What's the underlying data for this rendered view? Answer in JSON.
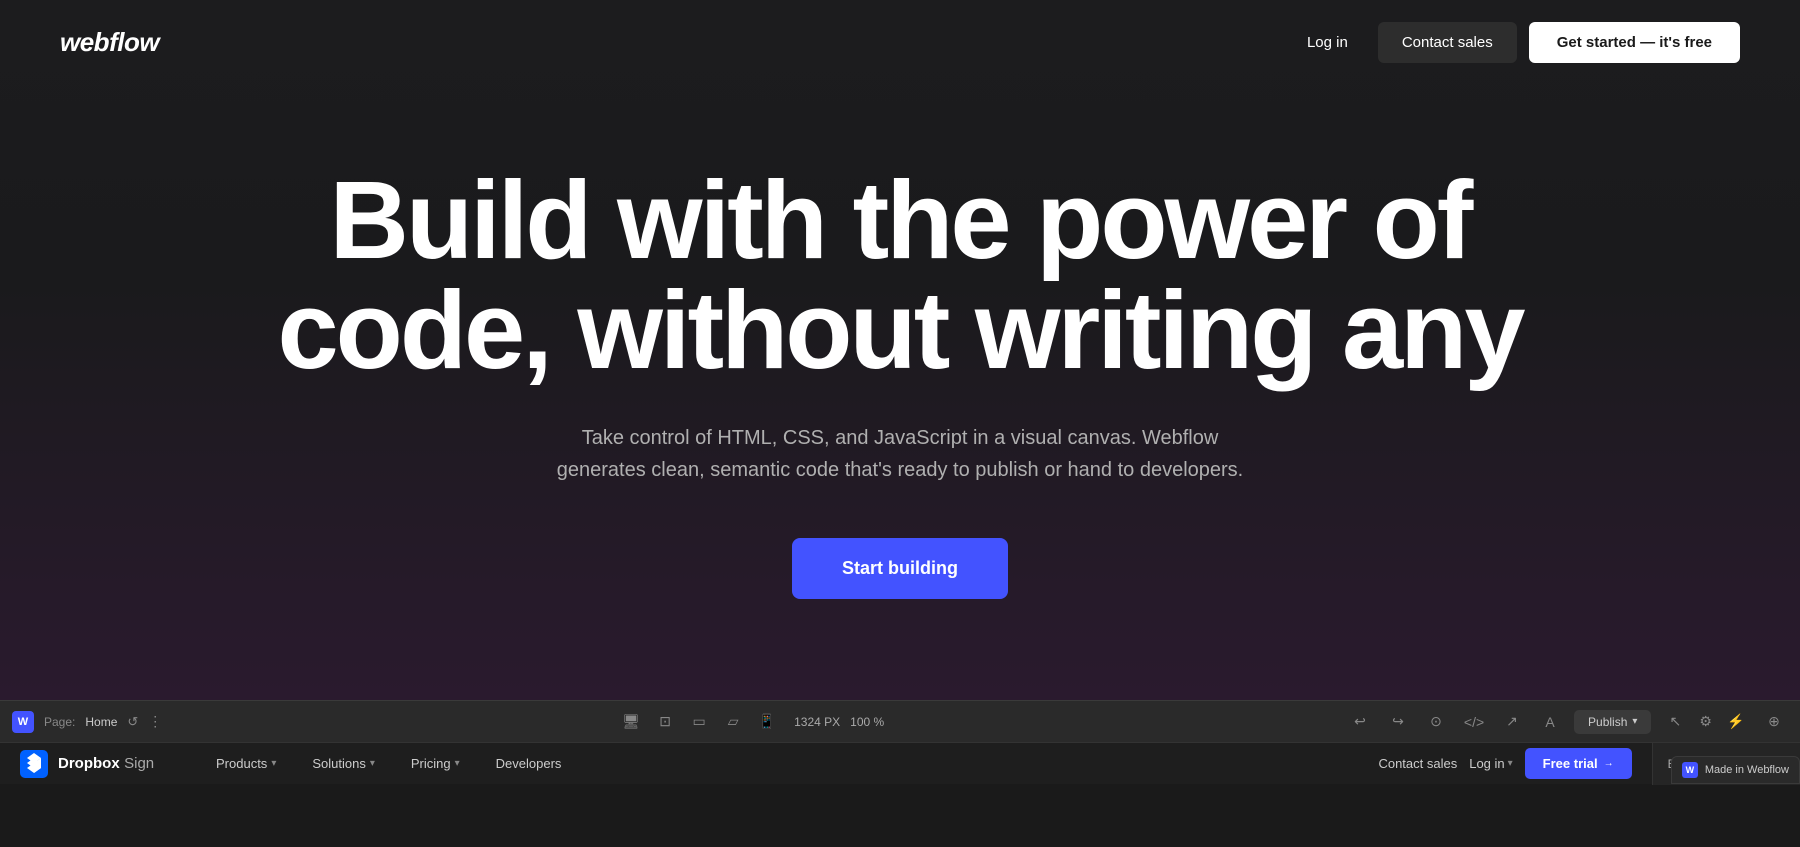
{
  "nav": {
    "logo": "webflow",
    "login_label": "Log in",
    "contact_label": "Contact sales",
    "get_started_label": "Get started — it's free"
  },
  "hero": {
    "title_line1": "Build with the power of",
    "title_line2": "code, without writing any",
    "subtitle": "Take control of HTML, CSS, and JavaScript in a visual canvas. Webflow generates clean, semantic code that's ready to publish or hand to developers.",
    "cta_label": "Start building"
  },
  "editor_bar": {
    "w_label": "W",
    "page_label": "Page:",
    "page_name": "Home",
    "size_label": "1324 PX",
    "zoom_label": "100 %",
    "publish_label": "Publish"
  },
  "browser_bar": {
    "logo_text": "Dropbox",
    "logo_sub": "Sign",
    "nav_items": [
      {
        "label": "Products",
        "has_chevron": true
      },
      {
        "label": "Solutions",
        "has_chevron": true
      },
      {
        "label": "Pricing",
        "has_chevron": true
      },
      {
        "label": "Developers",
        "has_chevron": false
      }
    ],
    "contact_label": "Contact sales",
    "login_label": "Log in",
    "free_trial_label": "Free trial",
    "bg_color_label": "Background Color Clo"
  },
  "made_in_webflow": {
    "icon_label": "W",
    "text": "Made in Webflow"
  },
  "colors": {
    "accent": "#4353ff",
    "bg_dark": "#1c1c1e",
    "nav_contact_bg": "#2d2d2d"
  }
}
